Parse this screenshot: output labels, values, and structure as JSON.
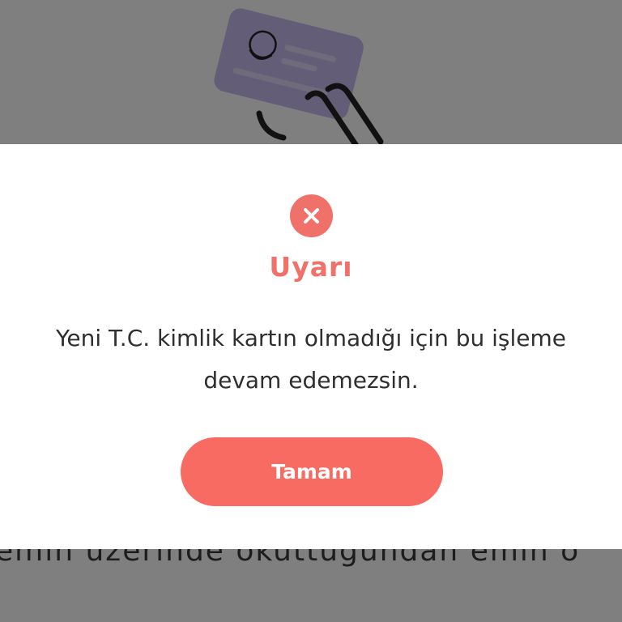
{
  "background": {
    "illustration_icon": "id-card-in-hand-illustration",
    "partial_text": "emin üzerinde okuttuğundan emin o"
  },
  "dialog": {
    "icon": "close-icon",
    "title": "Uyarı",
    "message": "Yeni T.C. kimlik kartın olmadığı için bu işleme devam edemezsin.",
    "button_label": "Tamam"
  },
  "colors": {
    "accent": "#f76b63",
    "title": "#f0706a",
    "text": "#2f2f2f",
    "overlay": "rgba(0,0,0,0.5)"
  }
}
